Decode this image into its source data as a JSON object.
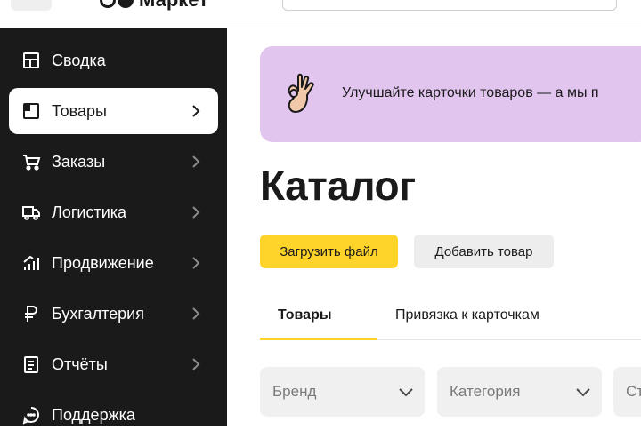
{
  "header": {
    "logo_text": "Маркет"
  },
  "sidebar": {
    "items": [
      {
        "label": "Сводка",
        "icon": "dashboard-icon"
      },
      {
        "label": "Товары",
        "icon": "goods-icon",
        "active": true
      },
      {
        "label": "Заказы",
        "icon": "cart-icon"
      },
      {
        "label": "Логистика",
        "icon": "truck-icon"
      },
      {
        "label": "Продвижение",
        "icon": "promotion-icon"
      },
      {
        "label": "Бухгалтерия",
        "icon": "ruble-icon"
      },
      {
        "label": "Отчёты",
        "icon": "report-icon"
      },
      {
        "label": "Поддержка",
        "icon": "chat-icon"
      }
    ]
  },
  "banner": {
    "text": "Улучшайте карточки товаров — а мы п",
    "icon": "ok-hand-icon"
  },
  "main": {
    "title": "Каталог",
    "buttons": {
      "upload": "Загрузить файл",
      "add": "Добавить товар"
    },
    "tabs": [
      {
        "label": "Товары",
        "active": true
      },
      {
        "label": "Привязка к карточкам"
      }
    ],
    "filters": [
      {
        "placeholder": "Бренд"
      },
      {
        "placeholder": "Категория"
      },
      {
        "placeholder": "Ст"
      }
    ]
  },
  "colors": {
    "sidebar_bg": "#1a1a1a",
    "accent_yellow": "#fed42b",
    "banner_bg": "#e2c5ef",
    "button_gray": "#ededed"
  }
}
